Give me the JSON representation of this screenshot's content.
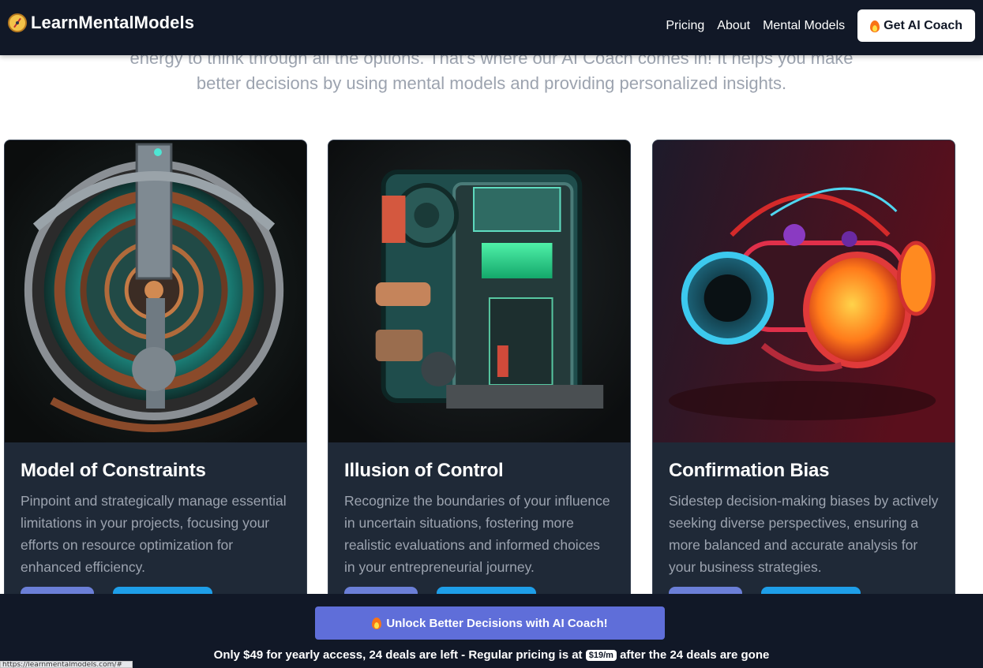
{
  "nav": {
    "brand": "LearnMentalModels",
    "links": [
      "Pricing",
      "About",
      "Mental Models"
    ],
    "cta_label": "Get AI Coach"
  },
  "intro": {
    "line1": "energy to think through all the options. That's where our AI Coach comes in! It helps you make",
    "line2": "better decisions by using mental models and providing personalized insights."
  },
  "cards": [
    {
      "title": "Model of Constraints",
      "description": "Pinpoint and strategically manage essential limitations in your projects, focusing your efforts on resource optimization for enhanced efficiency."
    },
    {
      "title": "Illusion of Control",
      "description": "Recognize the boundaries of your influence in uncertain situations, fostering more realistic evaluations and informed choices in your entrepreneurial journey."
    },
    {
      "title": "Confirmation Bias",
      "description": "Sidestep decision-making biases by actively seeking diverse perspectives, ensuring a more balanced and accurate analysis for your business strategies."
    }
  ],
  "bottom_bar": {
    "unlock_label": "Unlock Better Decisions with AI Coach!",
    "pricing_prefix": "Only $49 for yearly access, 24 deals are left - Regular pricing is at",
    "price_badge": "$19/m",
    "pricing_suffix": "after the 24 deals are gone"
  },
  "status_url": "https://learnmentalmodels.com/#"
}
